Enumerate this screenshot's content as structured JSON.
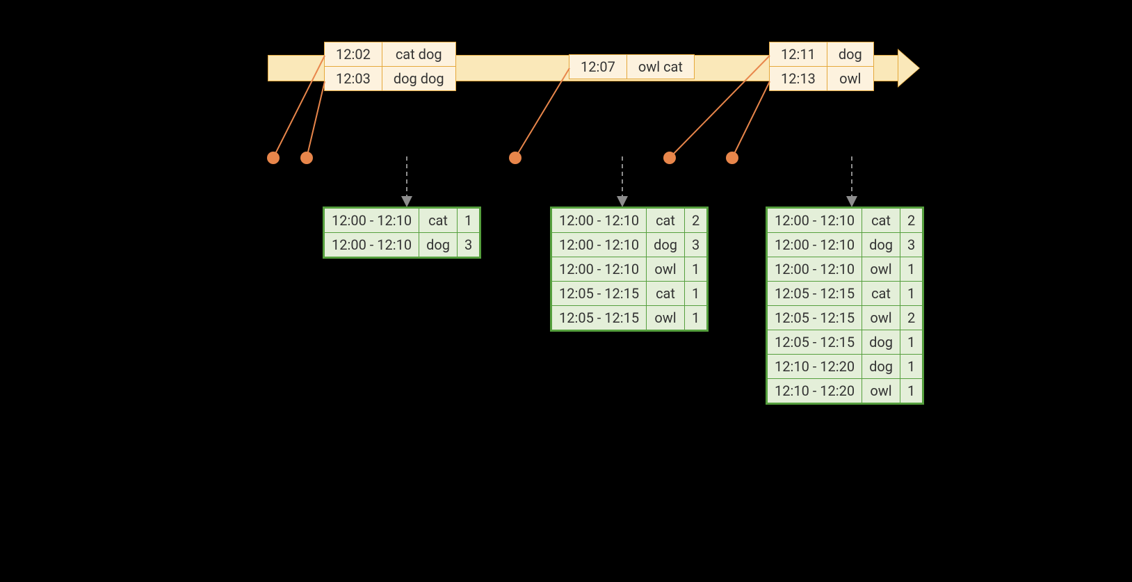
{
  "events": {
    "group1": [
      {
        "time": "12:02",
        "words": "cat dog"
      },
      {
        "time": "12:03",
        "words": "dog dog"
      }
    ],
    "group2": [
      {
        "time": "12:07",
        "words": "owl cat"
      }
    ],
    "group3": [
      {
        "time": "12:11",
        "words": "dog"
      },
      {
        "time": "12:13",
        "words": "owl"
      }
    ]
  },
  "results": {
    "r1": [
      {
        "window": "12:00 - 12:10",
        "word": "cat",
        "count": "1"
      },
      {
        "window": "12:00 - 12:10",
        "word": "dog",
        "count": "3"
      }
    ],
    "r2": [
      {
        "window": "12:00 - 12:10",
        "word": "cat",
        "count": "2"
      },
      {
        "window": "12:00 - 12:10",
        "word": "dog",
        "count": "3"
      },
      {
        "window": "12:00 - 12:10",
        "word": "owl",
        "count": "1"
      },
      {
        "window": "12:05 - 12:15",
        "word": "cat",
        "count": "1"
      },
      {
        "window": "12:05 - 12:15",
        "word": "owl",
        "count": "1"
      }
    ],
    "r3": [
      {
        "window": "12:00 - 12:10",
        "word": "cat",
        "count": "2"
      },
      {
        "window": "12:00 - 12:10",
        "word": "dog",
        "count": "3"
      },
      {
        "window": "12:00 - 12:10",
        "word": "owl",
        "count": "1"
      },
      {
        "window": "12:05 - 12:15",
        "word": "cat",
        "count": "1"
      },
      {
        "window": "12:05 - 12:15",
        "word": "owl",
        "count": "2"
      },
      {
        "window": "12:05 - 12:15",
        "word": "dog",
        "count": "1"
      },
      {
        "window": "12:10 - 12:20",
        "word": "dog",
        "count": "1"
      },
      {
        "window": "12:10 - 12:20",
        "word": "owl",
        "count": "1"
      }
    ]
  }
}
